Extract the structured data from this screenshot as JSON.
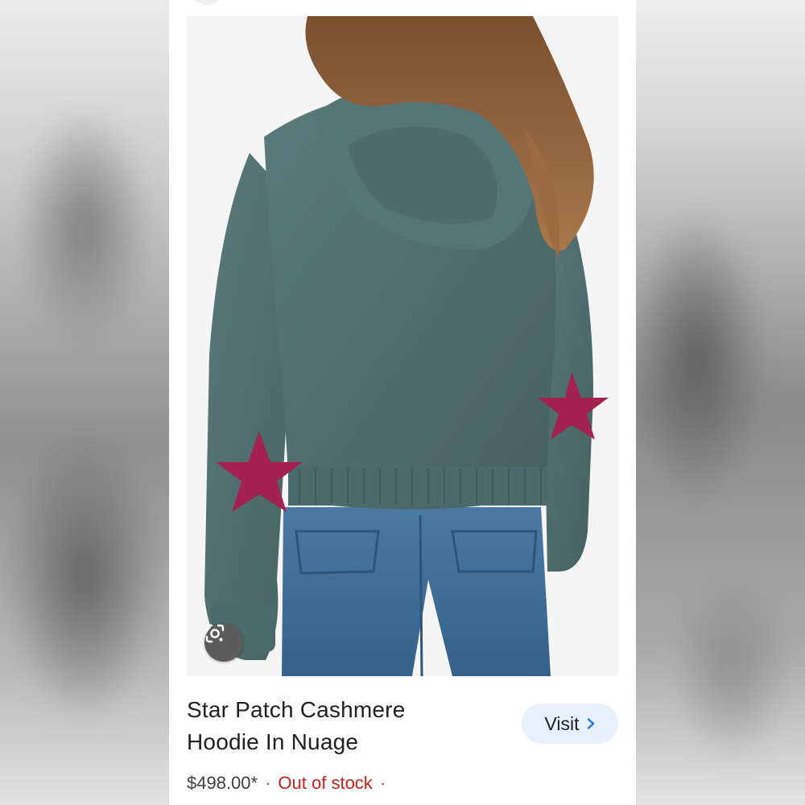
{
  "product": {
    "title_line1": "Star Patch Cashmere",
    "title_line2": "Hoodie In Nuage",
    "price": "$498.00*",
    "separator": "·",
    "availability": "Out of stock",
    "trailing_separator": "·"
  },
  "actions": {
    "visit_label": "Visit",
    "visit_icon": "chevron-right-icon",
    "lens_icon": "google-lens-icon"
  },
  "colors": {
    "availability": "#c5221f",
    "visit_background": "#e8f0fe",
    "sweater": "#4d6b6e",
    "star_patch": "#a3224f",
    "jeans": "#3f6f9a"
  }
}
